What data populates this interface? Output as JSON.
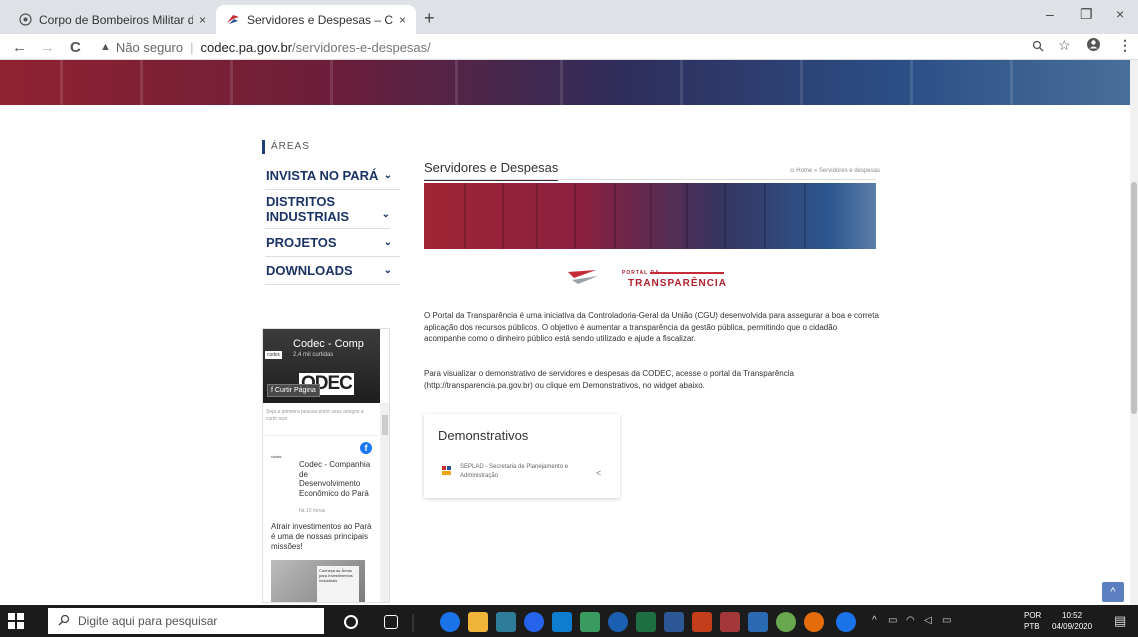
{
  "browser": {
    "tabs": [
      {
        "title": "Corpo de Bombeiros Militar do P",
        "close": "×"
      },
      {
        "title": "Servidores e Despesas – CODEC",
        "close": "×"
      }
    ],
    "new_tab": "+",
    "window_controls": {
      "minimize": "–",
      "maximize": "❐",
      "close": "×"
    },
    "nav": {
      "back": "←",
      "forward": "→",
      "reload": "C"
    },
    "address": {
      "security_icon": "▲",
      "security_label": "Não seguro",
      "separator": "|",
      "domain": "codec.pa.gov.br",
      "path": "/servidores-e-despesas/"
    }
  },
  "sidebar": {
    "title": "ÁREAS",
    "items": [
      {
        "label": "INVISTA NO PARÁ"
      },
      {
        "label": "DISTRITOS INDUSTRIAIS"
      },
      {
        "label": "PROJETOS"
      },
      {
        "label": "DOWNLOADS"
      }
    ],
    "chevron": "⌄"
  },
  "facebook": {
    "page_name": "Codec - Comp",
    "followers": "2,4 mil curtidas",
    "cover_logo": "codec",
    "big_text": "ODEC",
    "like_button": "Curtir Página",
    "first_friend": "Seja a primeira pessoa entre seus amigos a curtir isso",
    "post_logo": "codec",
    "post_org": "Codec - Companhia de Desenvolvimento Econômico do Pará",
    "post_time": "há 10 horas",
    "post_text": "Atrair investimentos ao Pará é uma de nossas principais missões!",
    "photo_text": "Conheça as Áreas para Investimentos Industriais"
  },
  "breadcrumb": {
    "home": "Home",
    "current": "Servidores e despesas"
  },
  "page": {
    "title": "Servidores e Despesas",
    "portal_small": "PORTAL DA",
    "portal_big": "TRANSPARÊNCIA",
    "para1": "O Portal da Transparência é uma iniciativa da Controladoria-Geral da União (CGU) desenvolvida para assegurar a boa e correta aplicação dos recursos públicos. O objetivo é aumentar a transparência da gestão pública, permitindo que o cidadão acompanhe como o dinheiro público está sendo utilizado e ajude a fiscalizar.",
    "para2": "Para visualizar o demonstrativo de servidores e despesas da CODEC, acesse o portal da Transparência (http://transparencia.pa.gov.br) ou clique em Demonstrativos, no widget abaixo."
  },
  "demonstrativos": {
    "title": "Demonstrativos",
    "link": "SEPLAD - Secretaria de Planejamento e Administração",
    "share": "<"
  },
  "scroll_top": "^",
  "taskbar": {
    "search_placeholder": "Digite aqui para pesquisar",
    "language": "POR",
    "keyboard": "PTB",
    "time": "10:52",
    "date": "04/09/2020"
  }
}
